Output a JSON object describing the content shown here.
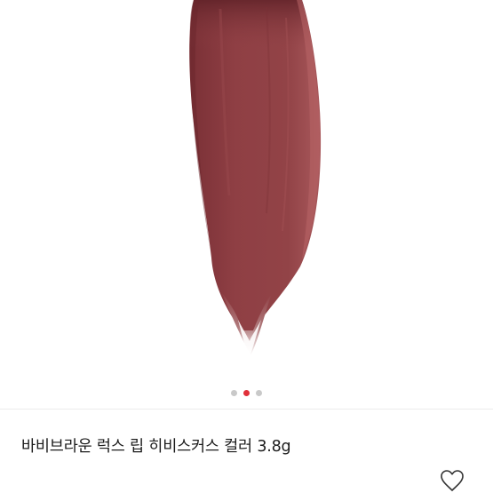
{
  "product": {
    "title": "바비브라운 럭스 립 히비스커스 컬러 3.8g",
    "swatch_color": "#8f3f44",
    "swatch_highlight": "#b25f63",
    "swatch_shadow": "#6e2a30"
  },
  "gallery": {
    "image_count": 3,
    "active_index": 1,
    "active_dot_color": "#e0303a",
    "inactive_dot_color": "#c9c9c9"
  },
  "icons": {
    "wishlist": "heart-outline-icon"
  }
}
